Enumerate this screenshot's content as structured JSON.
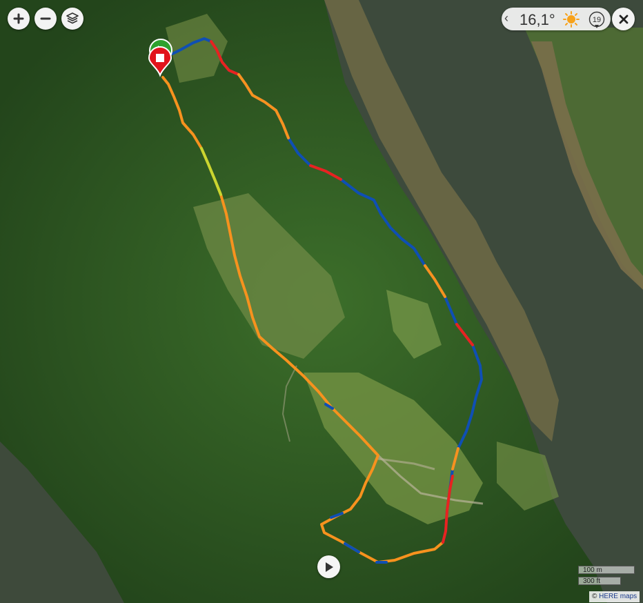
{
  "map_controls": {
    "zoom_in_icon": "plus-icon",
    "zoom_out_icon": "minus-icon",
    "layers_icon": "layers-icon"
  },
  "weather": {
    "back_icon": "chevron-left-icon",
    "temperature": "16,1°",
    "condition_icon": "sun-icon",
    "wind_speed": "19",
    "wind_icon": "wind-direction-icon"
  },
  "close_icon": "close-icon",
  "playback_icon": "play-icon",
  "scale_bar": {
    "metric": "100 m",
    "imperial": "300 ft"
  },
  "attribution": {
    "symbol": "©",
    "provider": "HERE maps"
  },
  "route": {
    "start_marker": "flag-green-icon",
    "end_marker": "stop-red-icon",
    "speed_colors": {
      "slow": "#e8231f",
      "medium": "#f7921e",
      "moderate": "#c9d630",
      "fast": "#0f4fb4"
    }
  }
}
